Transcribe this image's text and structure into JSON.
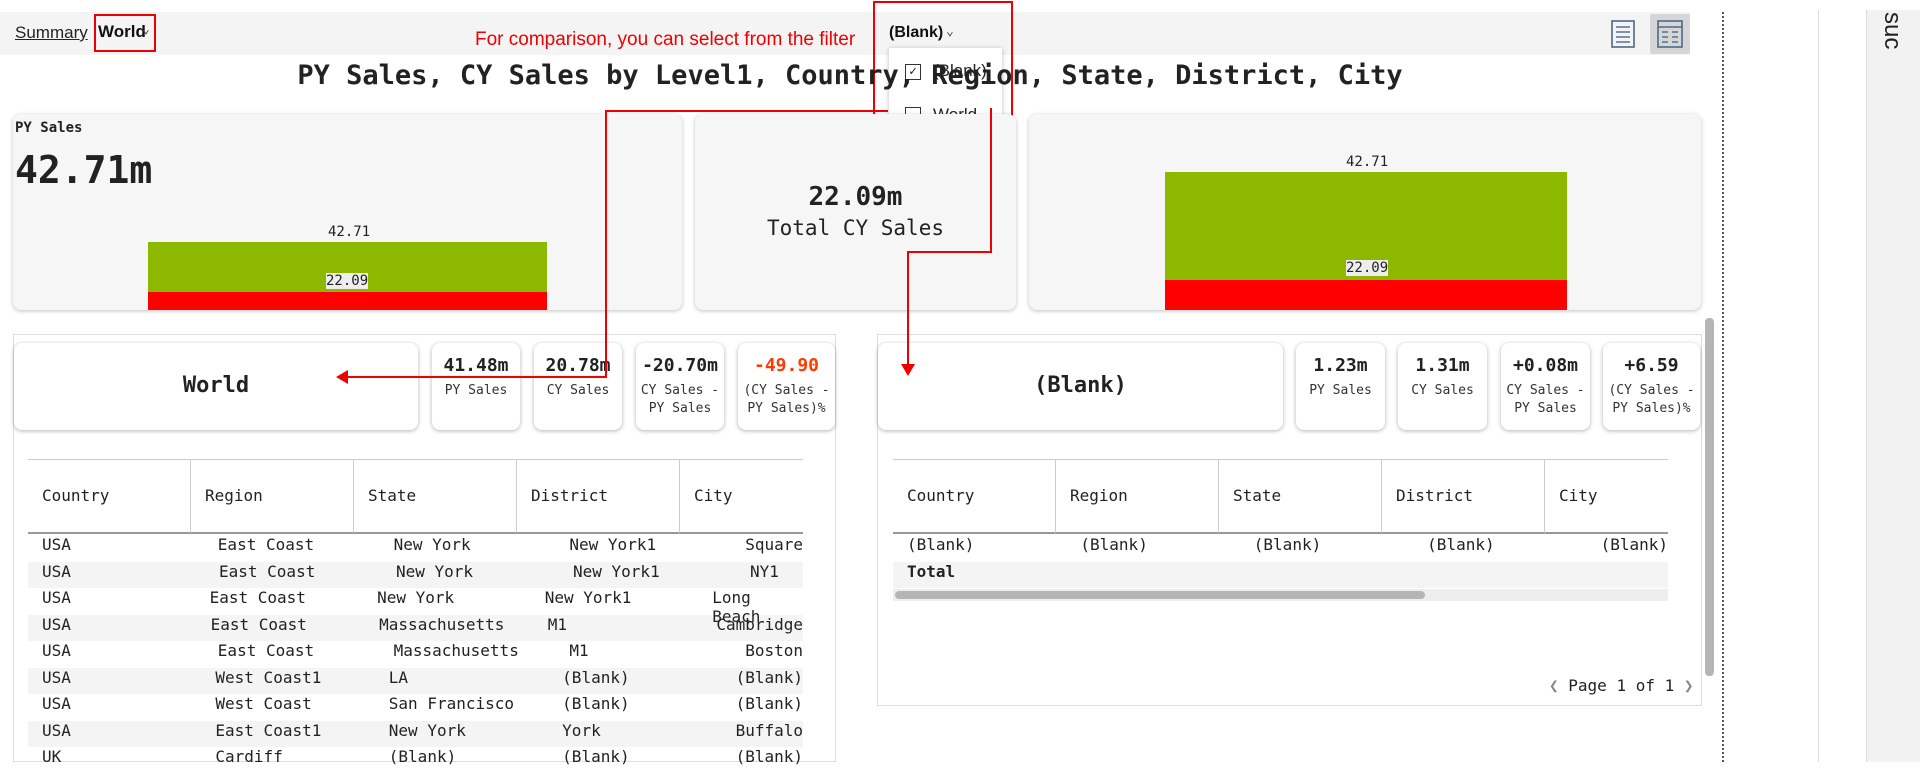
{
  "header": {
    "summary_label": "Summary",
    "world_label": "World",
    "note": "For comparison, you can select from the filter",
    "filter_label": "(Blank)",
    "filter_options": [
      {
        "label": "(Blank)",
        "checked": true
      },
      {
        "label": "World",
        "checked": false
      }
    ],
    "chevron": "chevron-down-icon"
  },
  "title": "PY Sales, CY Sales by Level1, Country, Region, State, District, City",
  "cards": {
    "py_title": "PY Sales",
    "py_value": "42.71m",
    "py_bar_top": "42.71",
    "py_bar_bottom": "22.09",
    "cy_value": "22.09m",
    "cy_label": "Total CY Sales",
    "right_bar_top": "42.71",
    "right_bar_bottom": "22.09"
  },
  "left_panel": {
    "name": "World",
    "kpis": [
      {
        "value": "41.48m",
        "label1": "PY Sales",
        "label2": ""
      },
      {
        "value": "20.78m",
        "label1": "CY Sales",
        "label2": ""
      },
      {
        "value": "-20.70m",
        "label1": "CY Sales -",
        "label2": "PY Sales"
      },
      {
        "value": "-49.90",
        "label1": "(CY Sales -",
        "label2": "PY Sales)%"
      }
    ],
    "columns": [
      "Country",
      "Region",
      "State",
      "District",
      "City"
    ],
    "rows": [
      [
        "USA",
        "East Coast",
        "New York",
        "New York1",
        "Square"
      ],
      [
        "USA",
        "East Coast",
        "New York",
        "New York1",
        "NY1"
      ],
      [
        "USA",
        "East Coast",
        "New York",
        "New York1",
        "Long Beach"
      ],
      [
        "USA",
        "East Coast",
        "Massachusetts",
        "M1",
        "Cambridge"
      ],
      [
        "USA",
        "East Coast",
        "Massachusetts",
        "M1",
        "Boston"
      ],
      [
        "USA",
        "West Coast1",
        "LA",
        "(Blank)",
        "(Blank)"
      ],
      [
        "USA",
        "West Coast",
        "San Francisco",
        "(Blank)",
        "(Blank)"
      ],
      [
        "USA",
        "East Coast1",
        "New York",
        "York",
        "Buffalo"
      ],
      [
        "UK",
        "Cardiff",
        "(Blank)",
        "(Blank)",
        "(Blank)"
      ]
    ]
  },
  "right_panel": {
    "name": "(Blank)",
    "kpis": [
      {
        "value": "1.23m",
        "label1": "PY Sales",
        "label2": ""
      },
      {
        "value": "1.31m",
        "label1": "CY Sales",
        "label2": ""
      },
      {
        "value": "+0.08m",
        "label1": "CY Sales -",
        "label2": "PY Sales"
      },
      {
        "value": "+6.59",
        "label1": "(CY Sales -",
        "label2": "PY Sales)%"
      }
    ],
    "columns": [
      "Country",
      "Region",
      "State",
      "District",
      "City"
    ],
    "rows": [
      [
        "(Blank)",
        "(Blank)",
        "(Blank)",
        "(Blank)",
        "(Blank)"
      ]
    ],
    "total_label": "Total",
    "pager": "Page 1 of 1"
  },
  "side_text": "suc",
  "colors": {
    "accent_red": "#e00000",
    "bar_green": "#8cb900",
    "neg_orange": "#ff3b00"
  }
}
